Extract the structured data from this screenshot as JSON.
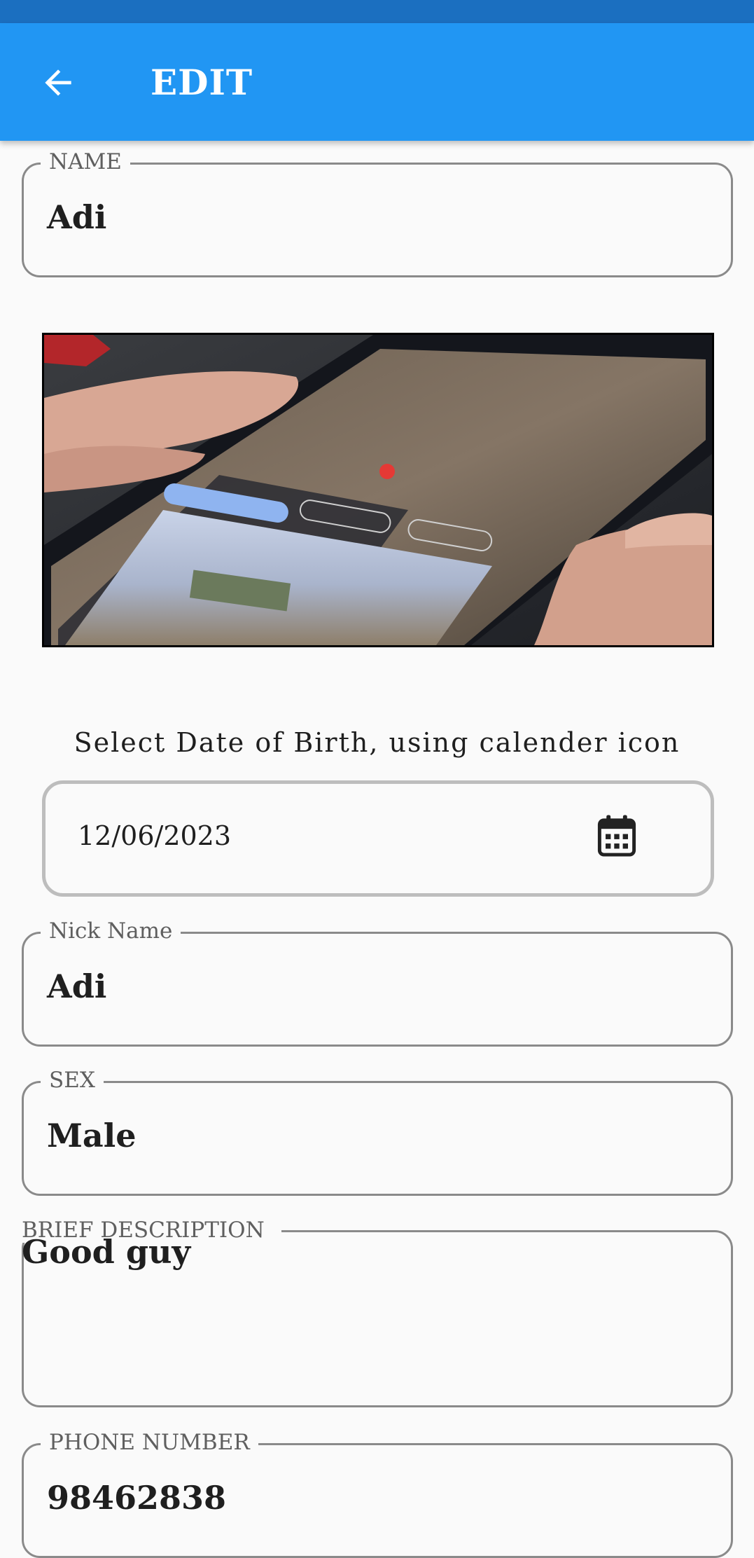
{
  "app_bar": {
    "title": "EDIT",
    "back_icon": "arrow-left-icon",
    "color": "#2196f3"
  },
  "form": {
    "name": {
      "label": "NAME",
      "value": "Adi"
    },
    "photo": {
      "description_icon": "photo-image"
    },
    "dob": {
      "caption": "Select Date of Birth, using calender icon",
      "value": "12/06/2023",
      "icon": "calendar-icon"
    },
    "nick_name": {
      "label": "Nick Name",
      "value": "Adi"
    },
    "sex": {
      "label": "SEX",
      "value": "Male"
    },
    "brief_description": {
      "label": "BRIEF DESCRIPTION",
      "value": "Good guy"
    },
    "phone_number": {
      "label": "PHONE NUMBER",
      "value": "98462838"
    }
  }
}
